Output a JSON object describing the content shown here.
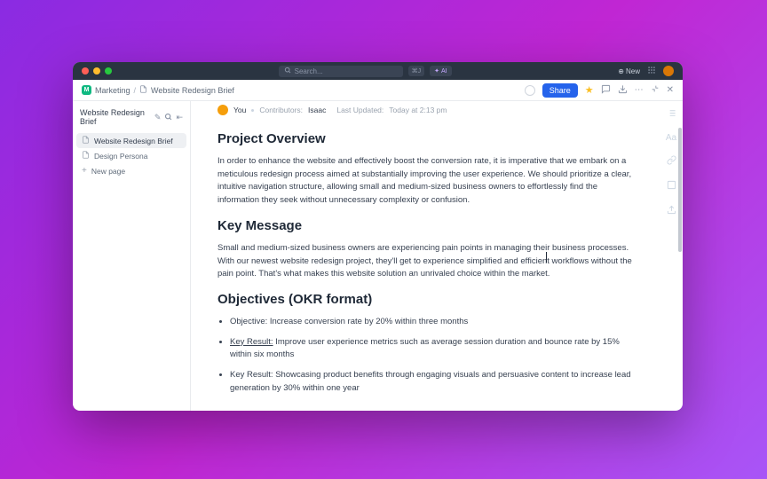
{
  "titlebar": {
    "search_placeholder": "Search...",
    "kbd": "⌘J",
    "ai_label": "AI",
    "new_label": "New"
  },
  "breadcrumb": {
    "workspace_letter": "M",
    "workspace": "Marketing",
    "page": "Website Redesign Brief"
  },
  "toolbar": {
    "share": "Share"
  },
  "sidebar": {
    "title": "Website Redesign Brief",
    "items": [
      {
        "label": "Website Redesign Brief",
        "active": true
      },
      {
        "label": "Design Persona",
        "active": false
      }
    ],
    "new_page": "New page"
  },
  "meta": {
    "you": "You",
    "contrib_label": "Contributors:",
    "contrib_value": "Isaac",
    "updated_label": "Last Updated:",
    "updated_value": "Today at 2:13 pm"
  },
  "doc": {
    "h1": "Project Overview",
    "p1": "In order to enhance the website and effectively boost the conversion rate, it is imperative that we embark on a meticulous redesign process aimed at substantially improving the user experience. We should prioritize a clear, intuitive navigation structure, allowing small and medium-sized business owners to effortlessly find the information they seek without unnecessary complexity or confusion.",
    "h2": "Key Message",
    "p2": "Small and medium-sized business owners are experiencing pain points in managing their business processes. With our newest website redesign project, they'll get to experience simplified and efficient workflows without the pain point. That's what makes this website solution an unrivaled choice within the market.",
    "h3": "Objectives (OKR format)",
    "li1": "Objective: Increase conversion rate by 20% within three months",
    "li2a": "Key Result:",
    "li2b": " Improve user experience metrics such as average session duration and bounce rate by 15% within six months",
    "li3": "Key Result: Showcasing product benefits through engaging visuals and persuasive content to increase lead generation by 30% within one year"
  },
  "rail": {
    "aa": "Aa"
  }
}
